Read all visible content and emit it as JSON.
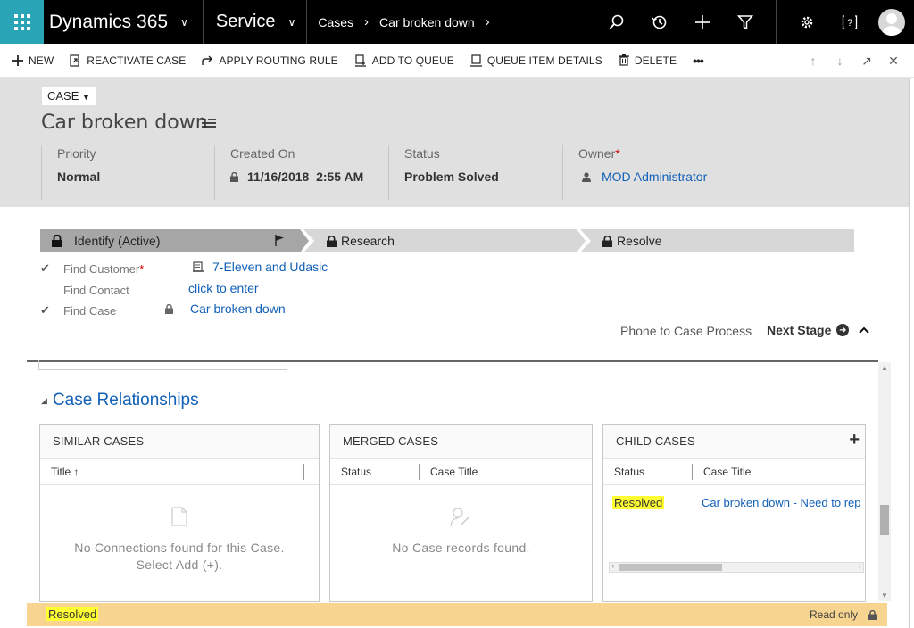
{
  "nav": {
    "app_name": "Dynamics 365",
    "area": "Service",
    "breadcrumb": [
      "Cases",
      "Car broken down"
    ]
  },
  "icons": {
    "waffle": "app-launcher-icon",
    "search": "search-icon",
    "recent": "history-icon",
    "new": "plus-icon",
    "filter": "filter-icon",
    "settings": "gear-icon",
    "help": "help-icon",
    "user": "avatar-icon"
  },
  "commands": [
    {
      "label": "NEW",
      "icon": "plus-icon"
    },
    {
      "label": "REACTIVATE CASE",
      "icon": "reactivate-icon"
    },
    {
      "label": "APPLY ROUTING RULE",
      "icon": "routing-icon"
    },
    {
      "label": "ADD TO QUEUE",
      "icon": "queue-add-icon"
    },
    {
      "label": "QUEUE ITEM DETAILS",
      "icon": "queue-details-icon"
    },
    {
      "label": "DELETE",
      "icon": "trash-icon"
    },
    {
      "label": "•••",
      "icon": "more-icon"
    }
  ],
  "header": {
    "entity": "CASE",
    "title": "Car broken down",
    "fields": [
      {
        "label": "Priority",
        "value": "Normal"
      },
      {
        "label": "Created On",
        "value": "11/16/2018  2:55 AM"
      },
      {
        "label": "Status",
        "value": "Problem Solved"
      },
      {
        "label": "Owner",
        "value": "MOD Administrator"
      }
    ]
  },
  "process": {
    "stages": [
      "Identify (Active)",
      "Research",
      "Resolve"
    ],
    "steps": [
      {
        "label": "Find Customer",
        "value": "7-Eleven and Udasic",
        "required": true
      },
      {
        "label": "Find Contact",
        "value": "click to enter",
        "required": false
      },
      {
        "label": "Find Case",
        "value": "Car broken down",
        "required": false
      }
    ],
    "process_name": "Phone to Case Process",
    "next_stage": "Next Stage"
  },
  "relationships": {
    "section_title": "Case Relationships",
    "similar": {
      "title": "SIMILAR CASES",
      "col": "Title ↑",
      "empty": [
        "No Connections found for this Case.",
        "Select Add (+)."
      ]
    },
    "merged": {
      "title": "MERGED CASES",
      "cols": [
        "Status",
        "Case Title"
      ],
      "empty": "No Case records found."
    },
    "child": {
      "title": "CHILD CASES",
      "add": "+",
      "cols": [
        "Status",
        "Case Title"
      ],
      "rows": [
        {
          "status": "Resolved",
          "title": "Car broken down - Need to rep"
        }
      ]
    }
  },
  "status_bar": {
    "status": "Resolved",
    "mode": "Read only"
  },
  "colors": {
    "accent": "#2aa5b8",
    "link": "#1160b7",
    "footer": "#f7d48f",
    "highlight": "#ffff33"
  }
}
